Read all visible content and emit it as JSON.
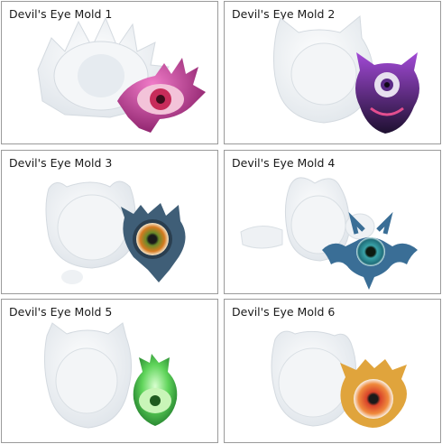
{
  "products": [
    {
      "label": "Devil's Eye Mold 1"
    },
    {
      "label": "Devil's Eye Mold 2"
    },
    {
      "label": "Devil's Eye Mold 3"
    },
    {
      "label": "Devil's Eye Mold 4"
    },
    {
      "label": "Devil's Eye Mold 5"
    },
    {
      "label": "Devil's Eye Mold 6"
    }
  ],
  "colors": {
    "border": "#9a9a9a",
    "mold": "#eef1f4",
    "casting_1": "#c2308f",
    "casting_2": "#3a2454",
    "casting_3": "#3f5e77",
    "casting_4": "#3a6e96",
    "casting_5": "#4ac24a",
    "casting_6": "#e0a43c"
  }
}
